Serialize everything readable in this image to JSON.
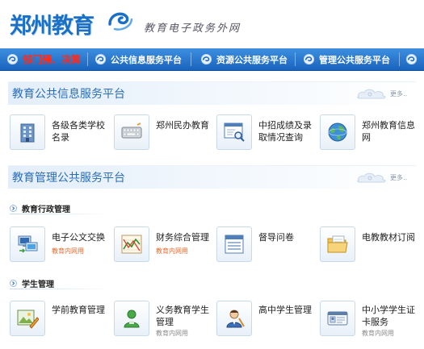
{
  "header": {
    "logo": "郑州教育",
    "subtitle": "教育电子政务外网"
  },
  "nav": [
    {
      "label": "部门预、决算",
      "color": "#ff2a1a"
    },
    {
      "label": "公共信息服务平台"
    },
    {
      "label": "资源公共服务平台"
    },
    {
      "label": "管理公共服务平台"
    }
  ],
  "section1": {
    "title": "教育公共信息服务平台",
    "more": "更多..",
    "tiles": [
      {
        "label": "各级各类学校名录",
        "icon": "building-icon"
      },
      {
        "label": "郑州民办教育",
        "icon": "keyboard-icon"
      },
      {
        "label": "中招成绩及录取情况查询",
        "icon": "search-window-icon"
      },
      {
        "label": "郑州教育信息网",
        "icon": "globe-icon"
      }
    ]
  },
  "section2": {
    "title": "教育管理公共服务平台",
    "more": "更多..",
    "groups": [
      {
        "heading": "教育行政管理",
        "tiles": [
          {
            "label": "电子公文交换",
            "note": "教育内网用",
            "icon": "computer-exchange-icon"
          },
          {
            "label": "财务综合管理",
            "note": "教育内网用",
            "icon": "finance-chart-icon"
          },
          {
            "label": "督导问卷",
            "icon": "questionnaire-icon"
          },
          {
            "label": "电教教材订阅",
            "icon": "folder-icon"
          }
        ]
      },
      {
        "heading": "学生管理",
        "tiles": [
          {
            "label": "学前教育管理",
            "icon": "picture-pen-icon"
          },
          {
            "label": "义务教育学生管理",
            "note": "教育内网用",
            "icon": "student-icon"
          },
          {
            "label": "高中学生管理",
            "icon": "teacher-icon"
          },
          {
            "label": "中小学学生证卡服务",
            "note": "教育内网用",
            "icon": "id-card-icon"
          }
        ]
      }
    ]
  },
  "colors": {
    "accent": "#1a64bd",
    "nav_red": "#ff2a1a",
    "note_orange": "#e26a2c",
    "note_gray": "#8b8b8b"
  }
}
